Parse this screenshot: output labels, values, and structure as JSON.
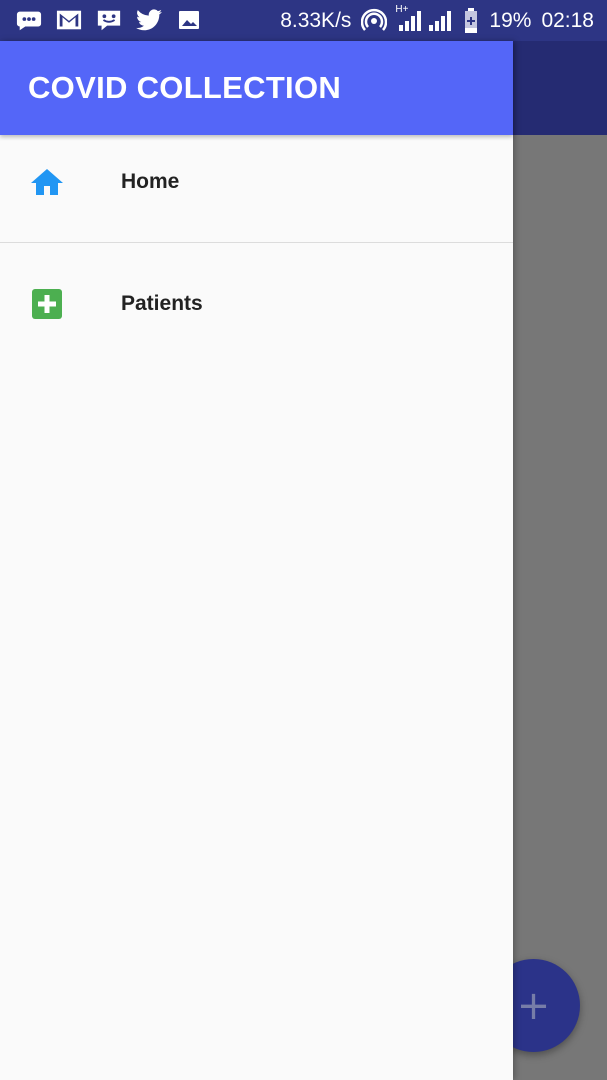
{
  "status_bar": {
    "left_icons": [
      "message-icon",
      "gmail-icon",
      "chat-icon",
      "twitter-icon",
      "image-icon"
    ],
    "network_speed": "8.33K/s",
    "network_type": "H+",
    "battery_percent": "19%",
    "time": "02:18"
  },
  "drawer": {
    "title": "COVID COLLECTION",
    "items": [
      {
        "label": "Home",
        "icon": "home-icon",
        "icon_color": "#2196f3"
      },
      {
        "label": "Patients",
        "icon": "plus-box-icon",
        "icon_color": "#4caf50"
      }
    ]
  },
  "fab": {
    "icon": "add-icon",
    "symbol": "+"
  },
  "colors": {
    "status_bar": "#2d3584",
    "drawer_header": "#5466f8",
    "drawer_bg": "#fafafa",
    "scrim": "#777777",
    "fab": "#2b3389"
  }
}
